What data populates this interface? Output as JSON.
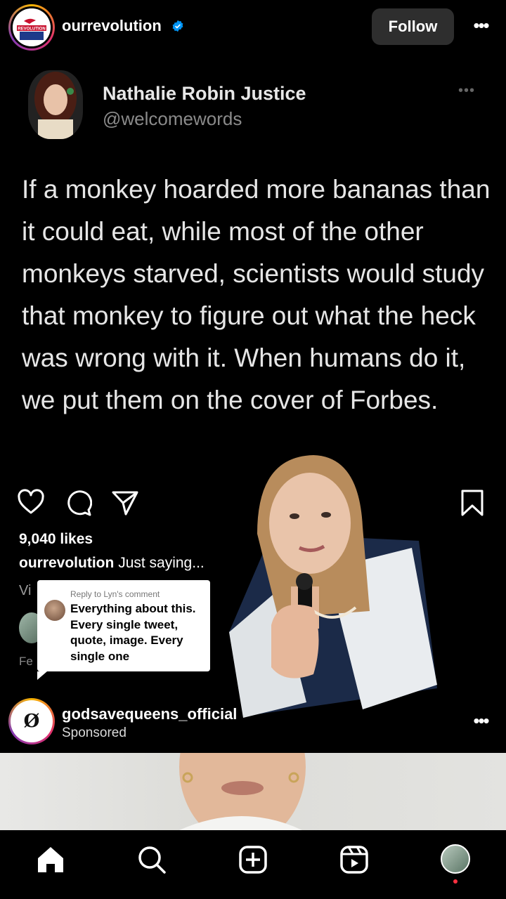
{
  "header": {
    "username": "ourrevolution",
    "follow_label": "Follow",
    "verified_icon": "verified-badge-icon",
    "more_icon": "more-horizontal-icon",
    "logo_text": "REVOLUTION"
  },
  "tweet": {
    "author_name": "Nathalie Robin Justice",
    "author_handle": "@welcomewords",
    "text": "If a monkey hoarded more bananas than it could eat, while most of the other monkeys starved, scientists would study that monkey to figure out what the heck was wrong with it. When humans do it, we put them on the cover of Forbes."
  },
  "post": {
    "likes": "9,040 likes",
    "caption_user": "ourrevolution",
    "caption_text": "Just saying...",
    "view_comments_cut": "Vi",
    "date_cut": "Fe"
  },
  "reply_card": {
    "label": "Reply to Lyn's comment",
    "text": "Everything about this. Every single tweet, quote, image. Every single one"
  },
  "sponsored": {
    "username": "godsavequeens_official",
    "label": "Sponsored",
    "logo_glyph": "Ø"
  },
  "nav": {
    "items": [
      "home-icon",
      "search-icon",
      "create-icon",
      "reels-icon",
      "profile-avatar"
    ]
  },
  "colors": {
    "background": "#000000",
    "follow_button": "#2e2e2e",
    "verified": "#0095f6",
    "notification": "#ff3040"
  }
}
